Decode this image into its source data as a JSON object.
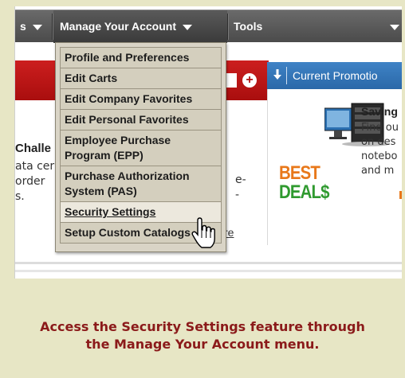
{
  "nav": {
    "left_item": "s",
    "manage": "Manage Your Account",
    "tools": "Tools"
  },
  "menu": {
    "items": [
      "Profile and Preferences",
      "Edit Carts",
      "Edit Company Favorites",
      "Edit Personal Favorites",
      "Employee Purchase Program (EPP)",
      "Purchase Authorization System (PAS)",
      "Security Settings",
      "Setup Custom Catalogs"
    ],
    "hovered_item": "Security Settings"
  },
  "page": {
    "left_bold": "Challe",
    "left_lines": [
      "ata cer",
      "order",
      "s."
    ],
    "right_lines": [
      "e-",
      "-"
    ],
    "link_fragment": "re",
    "plus_icon": "+"
  },
  "promo": {
    "header": "Current Promotio",
    "best": "BEST",
    "deals": "DEAL$",
    "saving": "Saving",
    "lines": [
      "Find ou",
      "on des",
      "notebo",
      "and m"
    ]
  },
  "caption": {
    "line1": "Access the Security Settings feature through",
    "line2": "the Manage Your Account menu."
  },
  "colors": {
    "frame_bg": "#e7e6c5",
    "navbar": "#555555",
    "banner_red": "#b81414",
    "promo_blue": "#3274b8",
    "caption": "#8b1a1a",
    "best_orange": "#e8781a",
    "deals_green": "#2f9a2f"
  }
}
